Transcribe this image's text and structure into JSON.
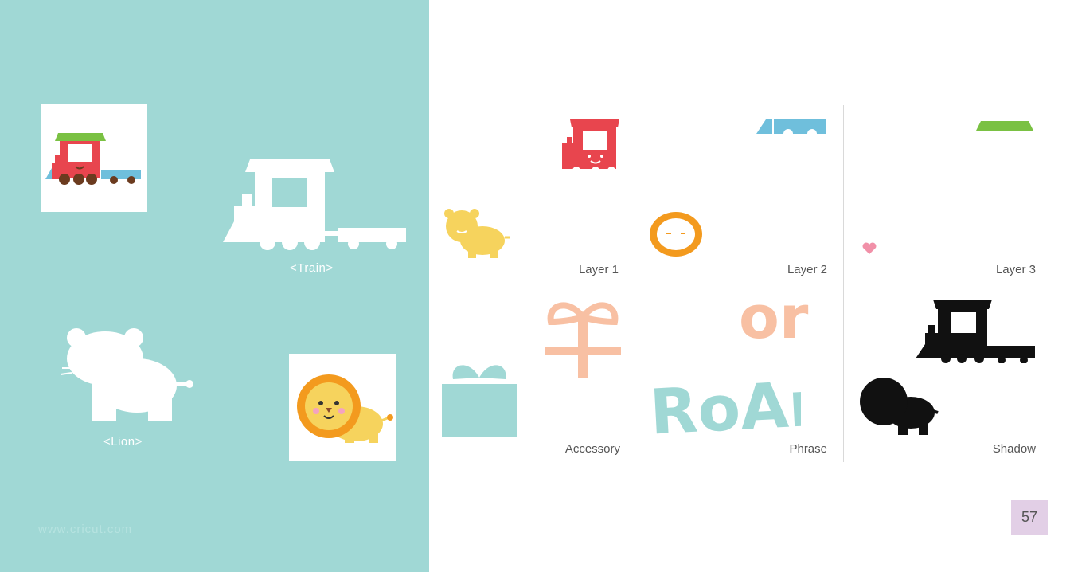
{
  "left_panel": {
    "captions": {
      "train": "<Train>",
      "lion": "<Lion>"
    },
    "watermark": "www.cricut.com"
  },
  "grid": {
    "labels": {
      "layer1": "Layer 1",
      "layer2": "Layer 2",
      "layer3": "Layer 3",
      "accessory": "Accessory",
      "phrase": "Phrase",
      "shadow": "Shadow"
    },
    "phrase_words": {
      "small": "or",
      "large": "RoAr"
    }
  },
  "page_number": "57",
  "colors": {
    "panel_bg": "#a0d8d5",
    "train_red": "#e8454e",
    "train_blue": "#6fbfdc",
    "roof_green": "#7ac143",
    "lion_yellow": "#f6d35d",
    "mane_orange": "#f39a1e",
    "gift_peach": "#f8c0a3",
    "gift_aqua": "#a0d8d5",
    "shadow_black": "#111111",
    "heart_pink": "#f190a8"
  },
  "icons": [
    "train-icon",
    "lion-icon",
    "gift-icon",
    "heart-icon"
  ]
}
